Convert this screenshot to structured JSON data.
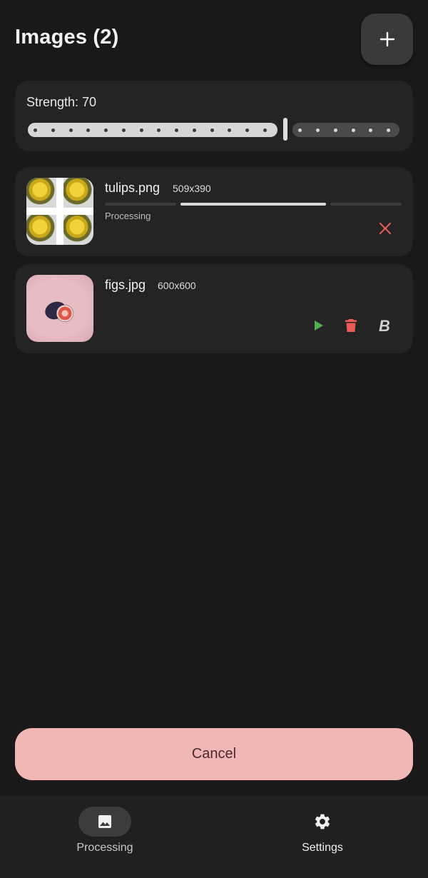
{
  "header": {
    "title": "Images (2)",
    "add_icon": "plus-icon"
  },
  "strength": {
    "label": "Strength: 70",
    "value": 70,
    "min": 0,
    "max": 100,
    "steps": 20
  },
  "images": [
    {
      "name": "tulips.png",
      "dimensions": "509x390",
      "status": "Processing",
      "action_icon": "close-icon"
    },
    {
      "name": "figs.jpg",
      "dimensions": "600x600",
      "actions": [
        "play-icon",
        "delete-icon",
        "bold-b-icon"
      ]
    }
  ],
  "cancel_label": "Cancel",
  "nav": [
    {
      "label": "Processing",
      "icon": "image-icon",
      "selected": true
    },
    {
      "label": "Settings",
      "icon": "gear-icon",
      "selected": false
    }
  ],
  "colors": {
    "background": "#191919",
    "card": "#242424",
    "cancel": "#f1b7b6",
    "danger": "#e85b57",
    "play": "#4caf50"
  }
}
